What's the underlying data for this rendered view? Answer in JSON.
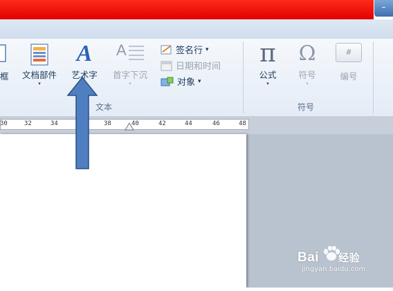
{
  "window": {
    "control_glyph": "–"
  },
  "ribbon": {
    "partial_label": "框",
    "quick_parts": "文档部件",
    "wordart": "艺术字",
    "dropcap": "首字下沉",
    "signature_line": "签名行",
    "date_time": "日期和时间",
    "object": "对象",
    "equation": "公式",
    "symbol": "符号",
    "number": "编号",
    "dropdown_glyph": "▾",
    "pi_glyph": "π",
    "omega_glyph": "Ω",
    "number_glyph": "#",
    "wordart_glyph": "A",
    "dropcap_glyph": "A"
  },
  "groups": {
    "text": "文本",
    "symbols": "符号"
  },
  "ruler": {
    "labels": [
      "30",
      "32",
      "34",
      "38",
      "40",
      "42",
      "44",
      "46",
      "48"
    ]
  },
  "watermark": {
    "brand": "Bai",
    "suffix": "经验",
    "url": "jingyan.baidu.com"
  },
  "colors": {
    "title_bar": "#e80000",
    "arrow_fill": "#4f7fc0",
    "arrow_stroke": "#2a4f86"
  }
}
